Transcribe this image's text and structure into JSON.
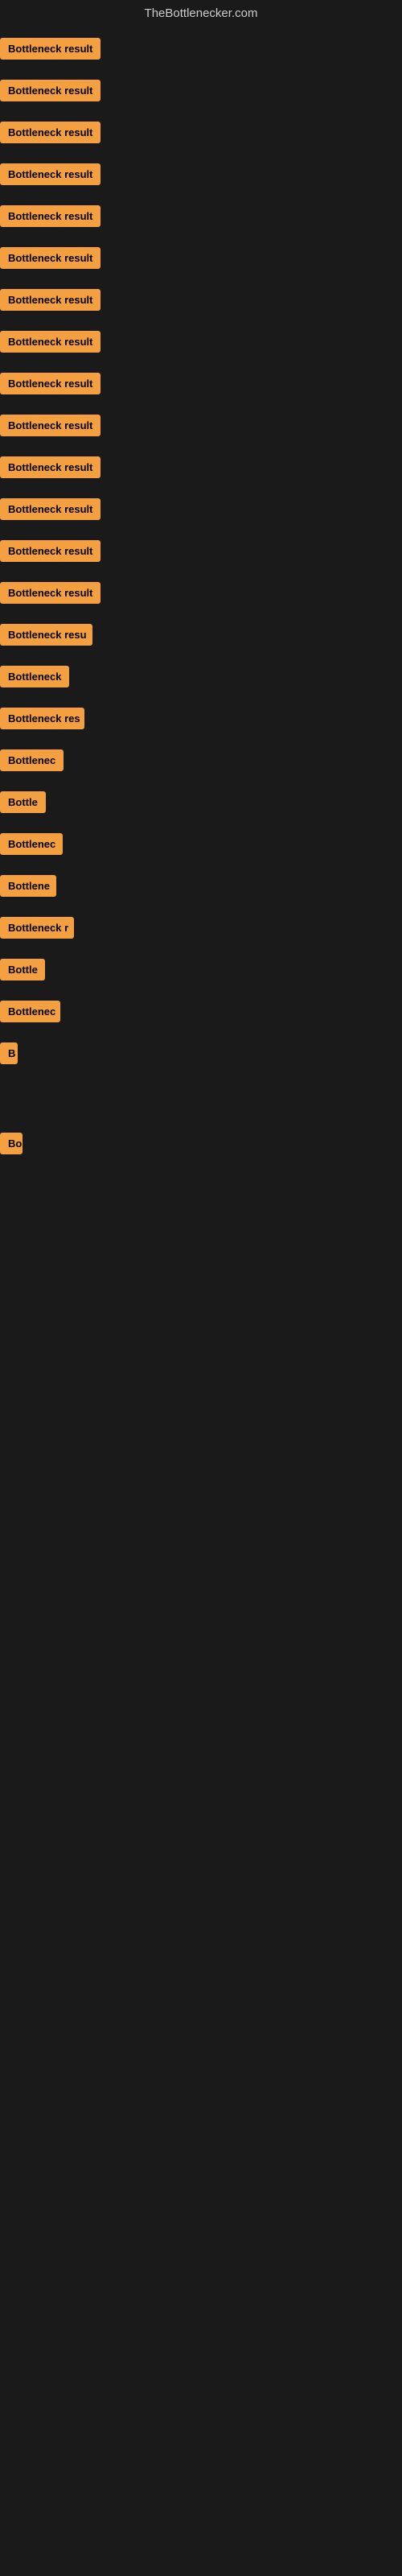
{
  "header": {
    "title": "TheBottlenecker.com"
  },
  "rows": [
    {
      "id": 1,
      "label": "Bottleneck result",
      "width": 140
    },
    {
      "id": 2,
      "label": "Bottleneck result",
      "width": 140
    },
    {
      "id": 3,
      "label": "Bottleneck result",
      "width": 140
    },
    {
      "id": 4,
      "label": "Bottleneck result",
      "width": 140
    },
    {
      "id": 5,
      "label": "Bottleneck result",
      "width": 140
    },
    {
      "id": 6,
      "label": "Bottleneck result",
      "width": 140
    },
    {
      "id": 7,
      "label": "Bottleneck result",
      "width": 140
    },
    {
      "id": 8,
      "label": "Bottleneck result",
      "width": 140
    },
    {
      "id": 9,
      "label": "Bottleneck result",
      "width": 140
    },
    {
      "id": 10,
      "label": "Bottleneck result",
      "width": 135
    },
    {
      "id": 11,
      "label": "Bottleneck result",
      "width": 132
    },
    {
      "id": 12,
      "label": "Bottleneck result",
      "width": 130
    },
    {
      "id": 13,
      "label": "Bottleneck result",
      "width": 128
    },
    {
      "id": 14,
      "label": "Bottleneck result",
      "width": 125
    },
    {
      "id": 15,
      "label": "Bottleneck resu",
      "width": 115
    },
    {
      "id": 16,
      "label": "Bottleneck",
      "width": 90
    },
    {
      "id": 17,
      "label": "Bottleneck res",
      "width": 105
    },
    {
      "id": 18,
      "label": "Bottlenec",
      "width": 80
    },
    {
      "id": 19,
      "label": "Bottle",
      "width": 58
    },
    {
      "id": 20,
      "label": "Bottlenec",
      "width": 78
    },
    {
      "id": 21,
      "label": "Bottlene",
      "width": 70
    },
    {
      "id": 22,
      "label": "Bottleneck r",
      "width": 92
    },
    {
      "id": 23,
      "label": "Bottle",
      "width": 56
    },
    {
      "id": 24,
      "label": "Bottlenec",
      "width": 75
    },
    {
      "id": 25,
      "label": "B",
      "width": 22
    },
    {
      "id": 26,
      "label": "",
      "width": 0
    },
    {
      "id": 27,
      "label": "",
      "width": 0
    },
    {
      "id": 28,
      "label": "",
      "width": 0
    },
    {
      "id": 29,
      "label": "Bo",
      "width": 28
    },
    {
      "id": 30,
      "label": "",
      "width": 0
    },
    {
      "id": 31,
      "label": "",
      "width": 0
    },
    {
      "id": 32,
      "label": "",
      "width": 0
    }
  ]
}
